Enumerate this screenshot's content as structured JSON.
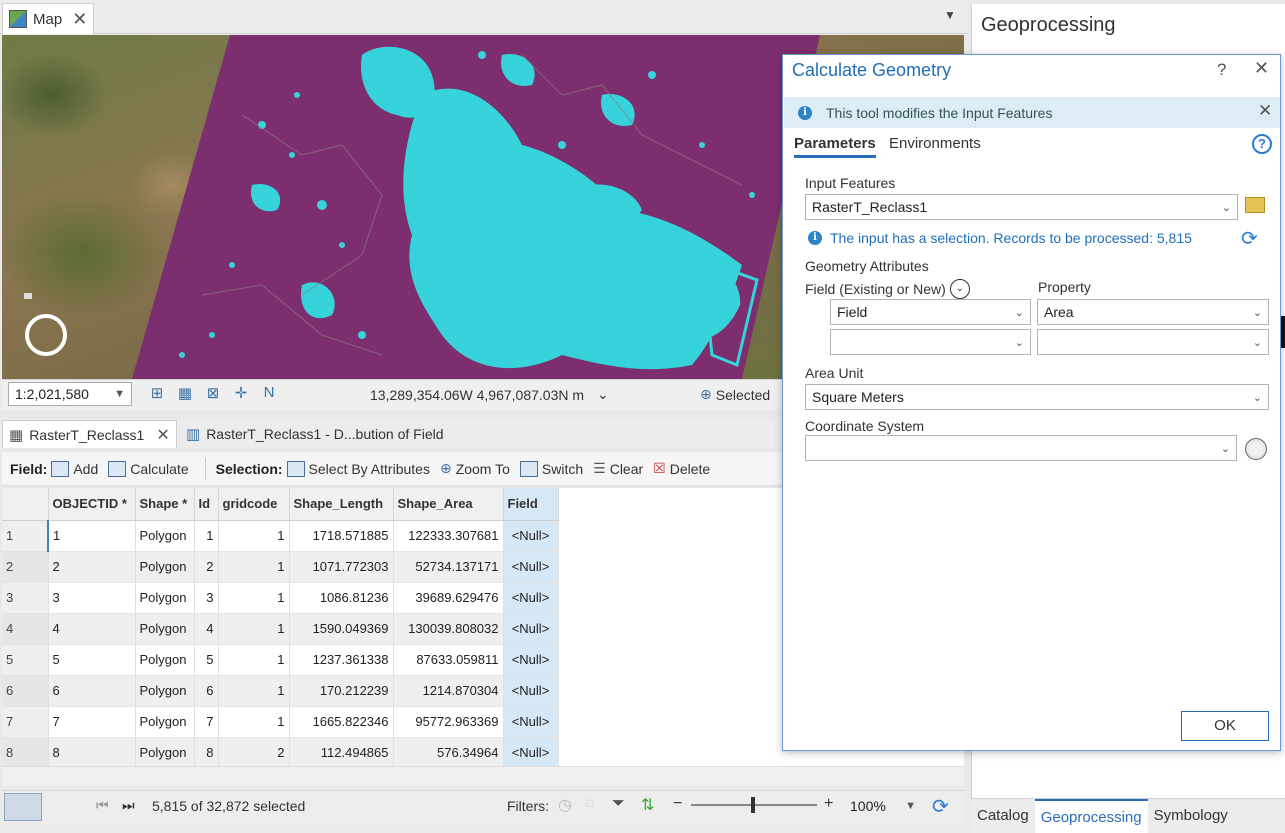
{
  "map_tab": {
    "label": "Map"
  },
  "map_status": {
    "scale": "1:2,021,580",
    "coordinates": "13,289,354.06W 4,967,087.03N m",
    "selected_label": "Selected"
  },
  "table_tabs": [
    {
      "label": "RasterT_Reclass1"
    },
    {
      "label": "RasterT_Reclass1 - D...bution of Field"
    }
  ],
  "table_toolbar": {
    "field_label": "Field:",
    "add": "Add",
    "calculate": "Calculate",
    "selection_label": "Selection:",
    "select_by_attributes": "Select By Attributes",
    "zoom_to": "Zoom To",
    "switch": "Switch",
    "clear": "Clear",
    "delete": "Delete"
  },
  "table": {
    "columns": [
      "OBJECTID *",
      "Shape *",
      "Id",
      "gridcode",
      "Shape_Length",
      "Shape_Area",
      "Field"
    ],
    "rows": [
      [
        "1",
        "1",
        "Polygon",
        "1",
        "1",
        "1718.571885",
        "122333.307681",
        "<Null>"
      ],
      [
        "2",
        "2",
        "Polygon",
        "2",
        "1",
        "1071.772303",
        "52734.137171",
        "<Null>"
      ],
      [
        "3",
        "3",
        "Polygon",
        "3",
        "1",
        "1086.81236",
        "39689.629476",
        "<Null>"
      ],
      [
        "4",
        "4",
        "Polygon",
        "4",
        "1",
        "1590.049369",
        "130039.808032",
        "<Null>"
      ],
      [
        "5",
        "5",
        "Polygon",
        "5",
        "1",
        "1237.361338",
        "87633.059811",
        "<Null>"
      ],
      [
        "6",
        "6",
        "Polygon",
        "6",
        "1",
        "170.212239",
        "1214.870304",
        "<Null>"
      ],
      [
        "7",
        "7",
        "Polygon",
        "7",
        "1",
        "1665.822346",
        "95772.963369",
        "<Null>"
      ],
      [
        "8",
        "8",
        "Polygon",
        "8",
        "2",
        "112.494865",
        "576.34964",
        "<Null>"
      ]
    ]
  },
  "table_footer": {
    "selection_count": "5,815 of 32,872 selected",
    "filters_label": "Filters:",
    "zoom_level": "100%"
  },
  "geoprocessing": {
    "pane_title": "Geoprocessing",
    "pane_tabs": [
      "Catalog",
      "Geoprocessing",
      "Symbology"
    ]
  },
  "dialog": {
    "title": "Calculate Geometry",
    "help_glyph": "?",
    "info_banner": "This tool modifies the Input Features",
    "tabs": {
      "parameters": "Parameters",
      "environments": "Environments"
    },
    "input_features_label": "Input Features",
    "input_features_value": "RasterT_Reclass1",
    "selection_info": "The input has a selection. Records to be processed: 5,815",
    "geometry_attributes_label": "Geometry Attributes",
    "field_label": "Field (Existing or New)",
    "property_label": "Property",
    "field_value": "Field",
    "property_value": "Area",
    "area_unit_label": "Area Unit",
    "area_unit_value": "Square Meters",
    "coordinate_system_label": "Coordinate System",
    "coordinate_system_value": "",
    "ok_label": "OK"
  },
  "colors": {
    "raster_purple": "#7d2e6e",
    "raster_cyan": "#36d3db",
    "accent_blue": "#1f6fb8",
    "selected_column": "#d6e7f6"
  }
}
